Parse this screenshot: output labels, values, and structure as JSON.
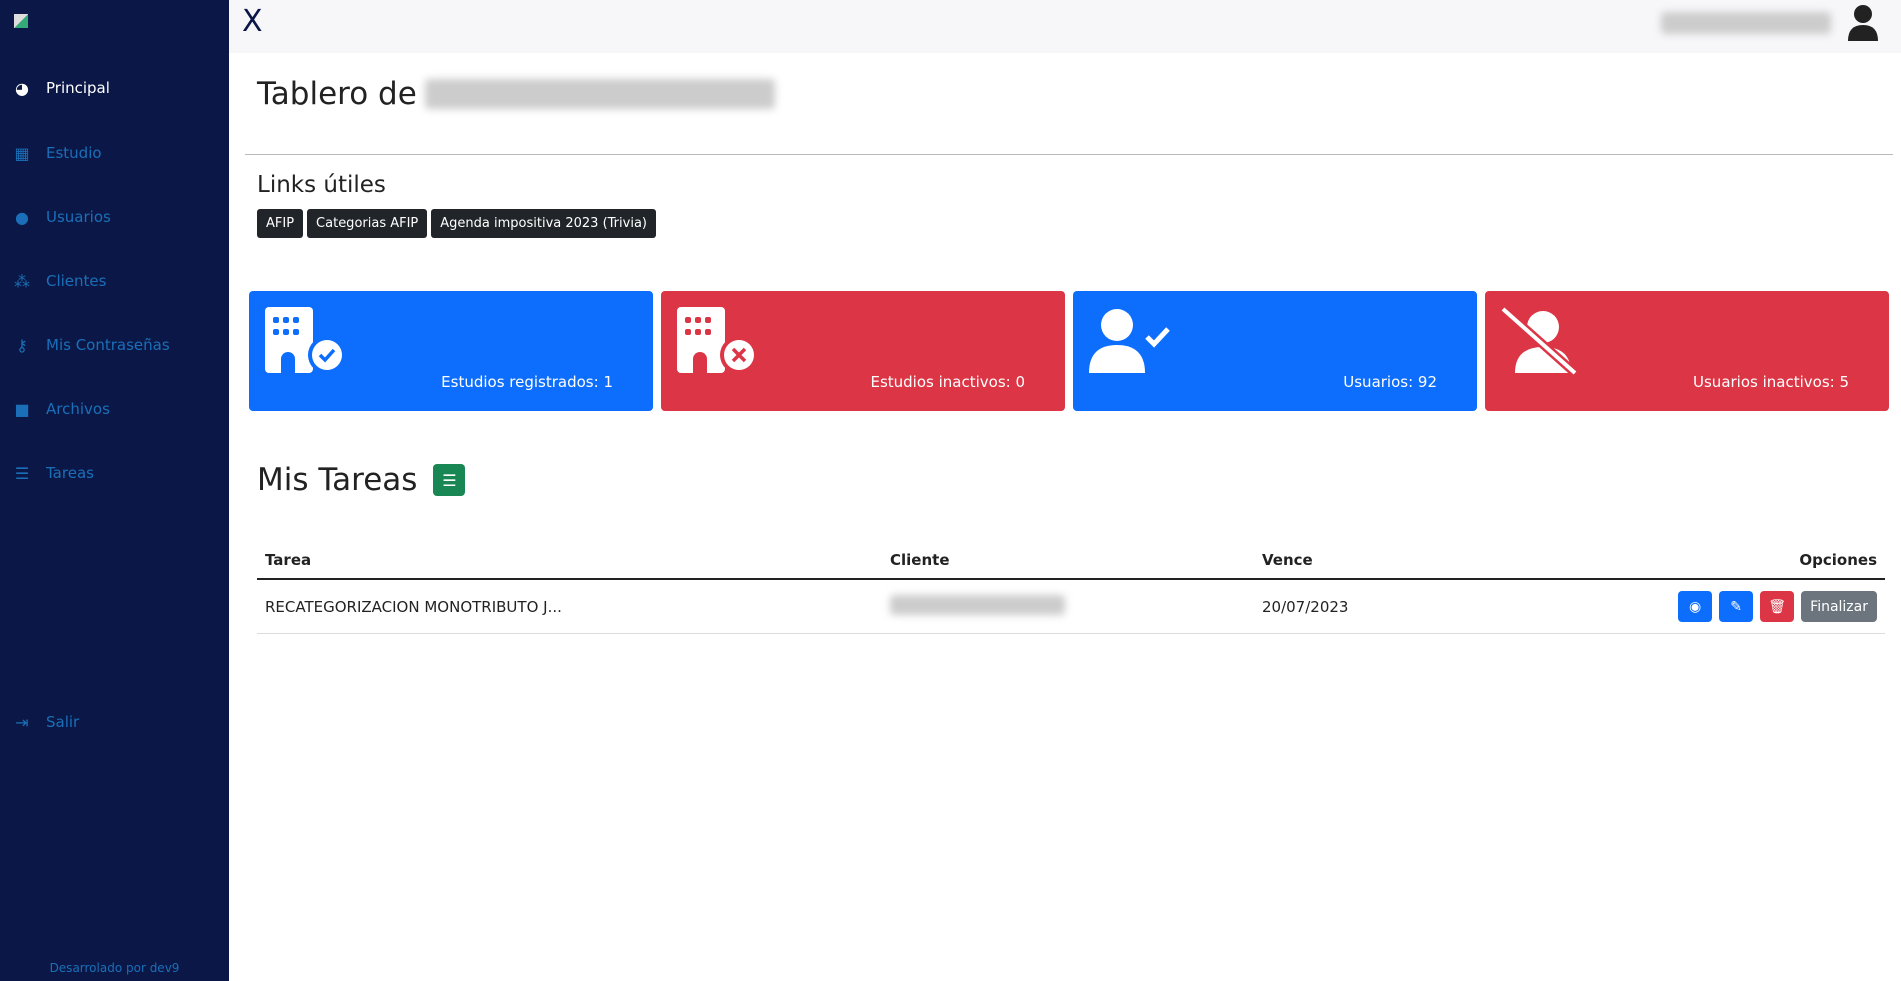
{
  "sidebar": {
    "items": [
      {
        "label": "Principal",
        "icon": "dashboard-icon",
        "active": true
      },
      {
        "label": "Estudio",
        "icon": "building-icon"
      },
      {
        "label": "Usuarios",
        "icon": "user-icon"
      },
      {
        "label": "Clientes",
        "icon": "users-icon"
      },
      {
        "label": "Mis Contraseñas",
        "icon": "key-icon"
      },
      {
        "label": "Archivos",
        "icon": "folder-icon"
      },
      {
        "label": "Tareas",
        "icon": "list-check-icon"
      }
    ],
    "logout": "Salir",
    "footer": "Desarrolado por dev9"
  },
  "header": {
    "close": "X"
  },
  "main": {
    "title": "Tablero de",
    "links_title": "Links útiles",
    "links": [
      "AFIP",
      "Categorias AFIP",
      "Agenda impositiva 2023 (Trivia)"
    ],
    "cards": [
      {
        "label": "Estudios registrados: 1",
        "color": "#0d6efd"
      },
      {
        "label": "Estudios inactivos: 0",
        "color": "#dc3545"
      },
      {
        "label": "Usuarios: 92",
        "color": "#0d6efd"
      },
      {
        "label": "Usuarios inactivos: 5",
        "color": "#dc3545"
      }
    ],
    "tasks_title": "Mis Tareas",
    "table": {
      "headers": [
        "Tarea",
        "Cliente",
        "Vence",
        "Opciones"
      ],
      "rows": [
        {
          "tarea": "RECATEGORIZACION MONOTRIBUTO J...",
          "vence": "20/07/2023",
          "finalizar": "Finalizar"
        }
      ]
    }
  }
}
